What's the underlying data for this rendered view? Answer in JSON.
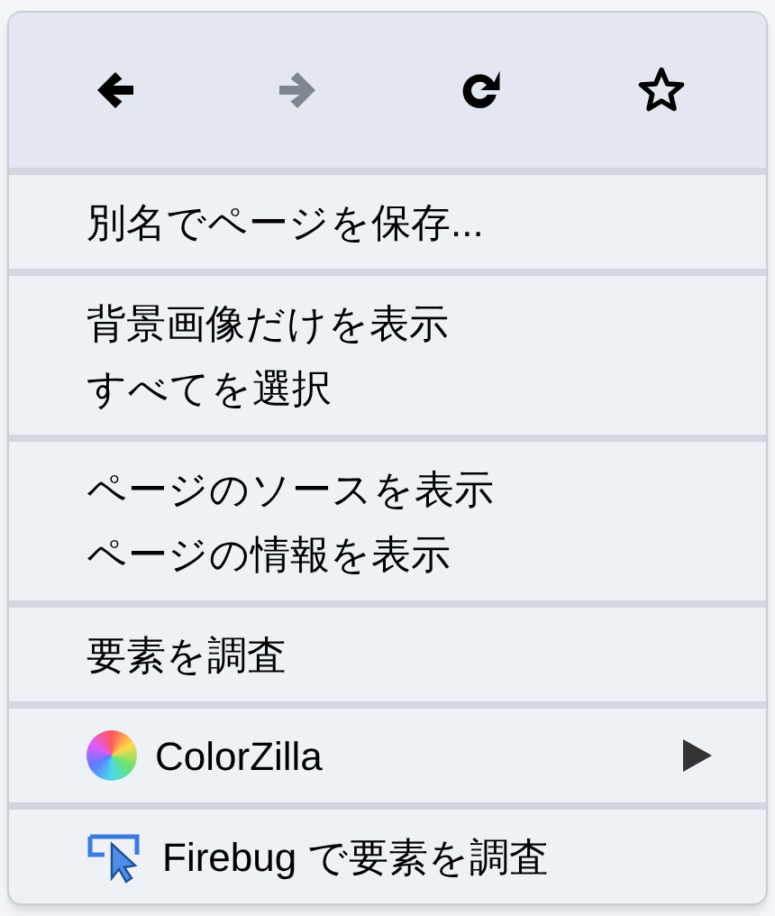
{
  "toolbar": [
    {
      "kind": "back",
      "disabled": false
    },
    {
      "kind": "forward",
      "disabled": true
    },
    {
      "kind": "reload",
      "disabled": false
    },
    {
      "kind": "bookmark",
      "disabled": false
    }
  ],
  "groups": [
    [
      {
        "label": "別名でページを保存...",
        "kind": "plain"
      }
    ],
    [
      {
        "label": "背景画像だけを表示",
        "kind": "plain"
      },
      {
        "label": "すべてを選択",
        "kind": "plain"
      }
    ],
    [
      {
        "label": "ページのソースを表示",
        "kind": "plain"
      },
      {
        "label": "ページの情報を表示",
        "kind": "plain"
      }
    ],
    [
      {
        "label": "要素を調査",
        "kind": "plain"
      }
    ],
    [
      {
        "label": "ColorZilla",
        "kind": "colorwheel",
        "submenu": true
      }
    ],
    [
      {
        "label": "Firebug で要素を調査",
        "kind": "inspect",
        "submenu": false
      }
    ]
  ]
}
